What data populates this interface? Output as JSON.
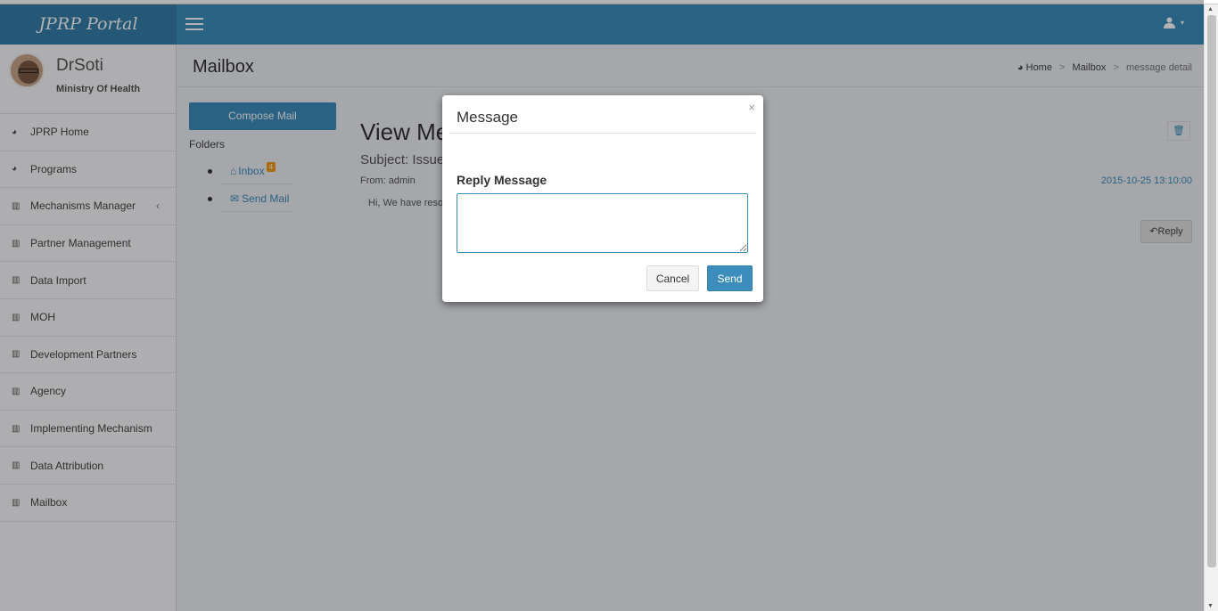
{
  "header": {
    "logo": "JPRP Portal",
    "user_icon": "user-icon"
  },
  "sidebar": {
    "username": "DrSoti",
    "role": "Ministry Of Health",
    "items": [
      {
        "label": "JPRP Home",
        "icon": "dashboard-icon"
      },
      {
        "label": "Programs",
        "icon": "dashboard-icon"
      },
      {
        "label": "Mechanisms Manager",
        "icon": "bar-chart-icon"
      },
      {
        "label": "Partner Management",
        "icon": "bar-chart-icon"
      },
      {
        "label": "Data Import",
        "icon": "bar-chart-icon"
      },
      {
        "label": "MOH",
        "icon": "bar-chart-icon"
      },
      {
        "label": "Development Partners",
        "icon": "bar-chart-icon"
      },
      {
        "label": "Agency",
        "icon": "bar-chart-icon"
      },
      {
        "label": "Implementing Mechanism",
        "icon": "bar-chart-icon"
      },
      {
        "label": "Data Attribution",
        "icon": "bar-chart-icon"
      },
      {
        "label": "Mailbox",
        "icon": "bar-chart-icon"
      }
    ]
  },
  "content": {
    "page_title": "Mailbox",
    "breadcrumb": {
      "home": "Home",
      "mailbox": "Mailbox",
      "current": "message detail"
    },
    "compose_label": "Compose Mail",
    "folders_label": "Folders",
    "folders": [
      {
        "label": "Inbox",
        "badge": "4"
      },
      {
        "label": "Send Mail"
      }
    ],
    "view_title": "View Me",
    "subject": "Subject: Issue",
    "from": "From: admin",
    "date": "2015-10-25 13:10:00",
    "body": "Hi, We have reso",
    "reply_label": "Reply"
  },
  "modal": {
    "title": "Message",
    "close": "×",
    "reply_label": "Reply Message",
    "reply_value": "",
    "cancel": "Cancel",
    "send": "Send"
  }
}
